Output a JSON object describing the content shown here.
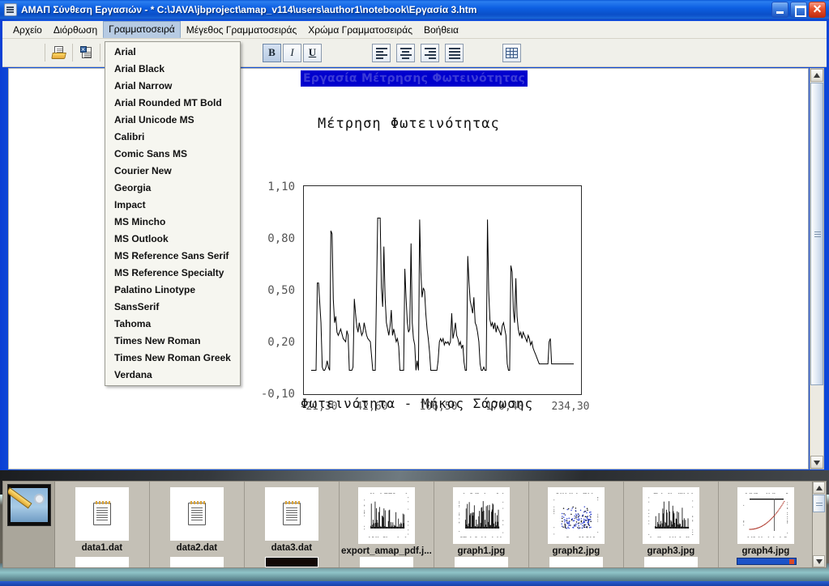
{
  "window": {
    "title": "ΑΜΑΠ Σύνθεση Εργασιών - * C:\\JAVA\\jbproject\\amap_v114\\users\\author1\\notebook\\Εργασία 3.htm",
    "icon": "app-icon",
    "buttons": {
      "minimize": "_",
      "maximize": "□",
      "close": "×"
    }
  },
  "menubar": {
    "items": [
      {
        "label": "Αρχείο",
        "active": false
      },
      {
        "label": "Διόρθωση",
        "active": false
      },
      {
        "label": "Γραμματοσειρά",
        "active": true
      },
      {
        "label": "Μέγεθος Γραμματοσειράς",
        "active": false
      },
      {
        "label": "Χρώμα Γραμματοσειράς",
        "active": false
      },
      {
        "label": "Βοήθεια",
        "active": false
      }
    ]
  },
  "toolbar": {
    "file_icons": [
      "open-document-icon",
      "export-document-icon",
      "library-book-icon"
    ],
    "bold_label": "B",
    "italic_label": "I",
    "underline_label": "U",
    "align_icons": [
      "align-left-icon",
      "align-center-icon",
      "align-right-icon",
      "align-justify-icon"
    ],
    "table_icon": "insert-table-icon"
  },
  "font_menu": {
    "open": true,
    "parent": "Γραμματοσειρά",
    "items": [
      "Arial",
      "Arial Black",
      "Arial Narrow",
      "Arial Rounded MT Bold",
      "Arial Unicode MS",
      "Calibri",
      "Comic Sans MS",
      "Courier New",
      "Georgia",
      "Impact",
      "MS Mincho",
      "MS Outlook",
      "MS Reference Sans Serif",
      "MS Reference Specialty",
      "Palatino Linotype",
      "SansSerif",
      "Tahoma",
      "Times New Roman",
      "Times New Roman Greek",
      "Verdana"
    ]
  },
  "document": {
    "heading": "Εργασία Μέτρησης Φωτεινότητας",
    "heading_selected": true,
    "heading_selection_color": "#0000cd",
    "heading_text_color": "#3b3bd6",
    "caption": "Φωτεινότητα - Μήκος Σάρωσης"
  },
  "chart_data": {
    "type": "line",
    "title": "Μέτρηση Φωτεινότητας",
    "xlabel": "",
    "ylabel": "",
    "caption": "Φωτεινότητα - Μήκος Σάρωσης",
    "grid": false,
    "legend": "none",
    "xlim": [
      -21.3,
      234.3
    ],
    "ylim": [
      -0.1,
      1.1
    ],
    "xticks": [
      "-21,30",
      "42,60",
      "106,50",
      "170,40",
      "234,30"
    ],
    "xtick_values": [
      -21.3,
      42.6,
      106.5,
      170.4,
      234.3
    ],
    "yticks": [
      "1,10",
      "0,80",
      "0,50",
      "0,20",
      "-0,10"
    ],
    "ytick_values": [
      1.1,
      0.8,
      0.5,
      0.2,
      -0.1
    ],
    "series": [
      {
        "name": "Φωτεινότητα",
        "color": "#000000",
        "x": [
          0,
          2,
          4,
          5,
          6,
          8,
          9,
          10,
          11,
          12,
          13,
          14,
          15,
          16,
          17,
          18,
          19,
          20,
          21,
          22,
          24,
          26,
          28,
          29,
          30,
          31,
          32,
          33,
          34,
          35,
          36,
          37,
          38,
          39,
          40,
          41,
          42,
          43,
          44,
          45,
          46,
          48,
          50,
          52,
          54,
          56,
          57,
          58,
          59,
          60,
          61,
          62,
          63,
          64,
          65,
          66,
          67,
          68,
          69,
          70,
          71,
          72,
          73,
          74,
          75,
          76,
          77,
          78,
          79,
          80,
          81,
          82,
          83,
          84,
          85,
          86,
          87,
          88,
          89,
          90,
          91,
          92,
          93,
          94,
          95,
          96,
          97,
          98,
          99,
          100,
          101,
          102,
          103,
          104,
          105,
          106,
          107,
          108,
          109,
          110,
          111,
          112,
          113,
          114,
          115,
          116,
          117,
          118,
          119,
          120,
          121,
          122,
          123,
          124,
          125,
          126,
          127,
          128,
          129,
          130,
          131,
          132,
          133,
          134,
          135,
          136,
          137,
          138,
          139,
          140,
          141,
          142,
          143,
          144,
          145,
          146,
          147,
          148,
          149,
          150,
          151,
          152,
          153,
          154,
          155,
          156,
          157,
          158,
          159,
          160,
          161,
          162,
          163,
          164,
          165,
          166,
          167,
          168,
          169,
          170,
          171,
          172,
          173,
          174,
          175,
          176,
          177,
          178,
          179,
          180,
          181,
          182,
          183,
          184,
          185,
          186,
          187,
          188,
          189,
          190,
          191,
          192,
          193,
          194,
          195,
          196,
          197,
          198,
          199,
          200,
          201,
          202,
          203,
          204,
          205,
          206,
          207,
          208,
          209,
          210,
          211,
          212,
          213
        ],
        "y": [
          0.0,
          0.0,
          0.0,
          0.55,
          0.55,
          0.3,
          0.02,
          0.0,
          0.0,
          0.02,
          0.06,
          0.02,
          0.0,
          0.88,
          0.86,
          0.45,
          0.3,
          0.34,
          0.24,
          0.22,
          0.26,
          0.2,
          0.18,
          0.25,
          0.22,
          0.0,
          0.0,
          0.0,
          0.02,
          0.45,
          0.36,
          0.28,
          0.24,
          0.3,
          0.26,
          0.22,
          0.24,
          0.3,
          0.26,
          0.22,
          0.2,
          0.18,
          0.0,
          0.0,
          0.96,
          0.96,
          0.52,
          0.4,
          0.78,
          0.46,
          0.3,
          0.26,
          0.22,
          0.28,
          0.38,
          0.22,
          0.26,
          0.22,
          0.18,
          0.2,
          0.15,
          0.0,
          0.0,
          0.0,
          0.0,
          0.64,
          0.46,
          0.3,
          0.24,
          0.26,
          0.8,
          0.3,
          0.2,
          0.16,
          0.0,
          0.06,
          0.0,
          0.95,
          0.62,
          0.46,
          0.52,
          0.5,
          0.36,
          0.26,
          0.2,
          0.12,
          0.0,
          0.0,
          0.0,
          0.0,
          0.0,
          0.0,
          0.06,
          0.18,
          0.2,
          0.18,
          0.2,
          0.16,
          0.18,
          0.17,
          0.18,
          0.16,
          0.18,
          0.36,
          0.2,
          0.24,
          0.3,
          0.22,
          0.2,
          0.16,
          0.18,
          0.14,
          0.16,
          0.05,
          0.0,
          0.0,
          0.72,
          0.56,
          0.44,
          0.4,
          0.36,
          0.46,
          0.3,
          0.28,
          0.24,
          0.18,
          0.04,
          0.0,
          0.0,
          0.02,
          0.0,
          0.0,
          0.95,
          0.5,
          0.32,
          0.28,
          0.3,
          0.26,
          0.3,
          0.24,
          0.28,
          0.26,
          0.24,
          0.22,
          0.28,
          0.3,
          0.26,
          0.22,
          0.04,
          0.0,
          0.0,
          0.66,
          0.62,
          0.38,
          0.3,
          0.58,
          0.34,
          0.26,
          0.22,
          0.24,
          0.2,
          0.24,
          0.22,
          0.2,
          0.18,
          0.22,
          0.2,
          0.16,
          0.18,
          0.14,
          0.12,
          0.1,
          0.08,
          0.06,
          0.04,
          0.04,
          0.04,
          0.04,
          0.04,
          0.04,
          0.04,
          0.04,
          0.18,
          0.2,
          0.04,
          0.04,
          0.04,
          0.04,
          0.04,
          0.04,
          0.04,
          0.04,
          0.04,
          0.04,
          0.04,
          0.04,
          0.04,
          0.04,
          0.04,
          0.04,
          0.04,
          0.04,
          0.04,
          0.04,
          0.04,
          0.04,
          0.04,
          0.04,
          0.04,
          0.04,
          0.04
        ]
      }
    ]
  },
  "file_browser": {
    "preview_icon": "image-editor-preview",
    "files": [
      {
        "name": "data1.dat",
        "icon": "text-file-icon"
      },
      {
        "name": "data2.dat",
        "icon": "text-file-icon"
      },
      {
        "name": "data3.dat",
        "icon": "text-file-icon"
      },
      {
        "name": "export_amap_pdf.j...",
        "icon": "chart-thumbnail"
      },
      {
        "name": "graph1.jpg",
        "icon": "chart-thumbnail"
      },
      {
        "name": "graph2.jpg",
        "icon": "chart-thumbnail"
      },
      {
        "name": "graph3.jpg",
        "icon": "chart-thumbnail"
      },
      {
        "name": "graph4.jpg",
        "icon": "chart-thumbnail"
      }
    ]
  },
  "scrollbars": {
    "document_vertical": {
      "up": "▲",
      "down": "▼"
    },
    "browser_vertical": {
      "up": "▲",
      "down": "▼"
    }
  }
}
